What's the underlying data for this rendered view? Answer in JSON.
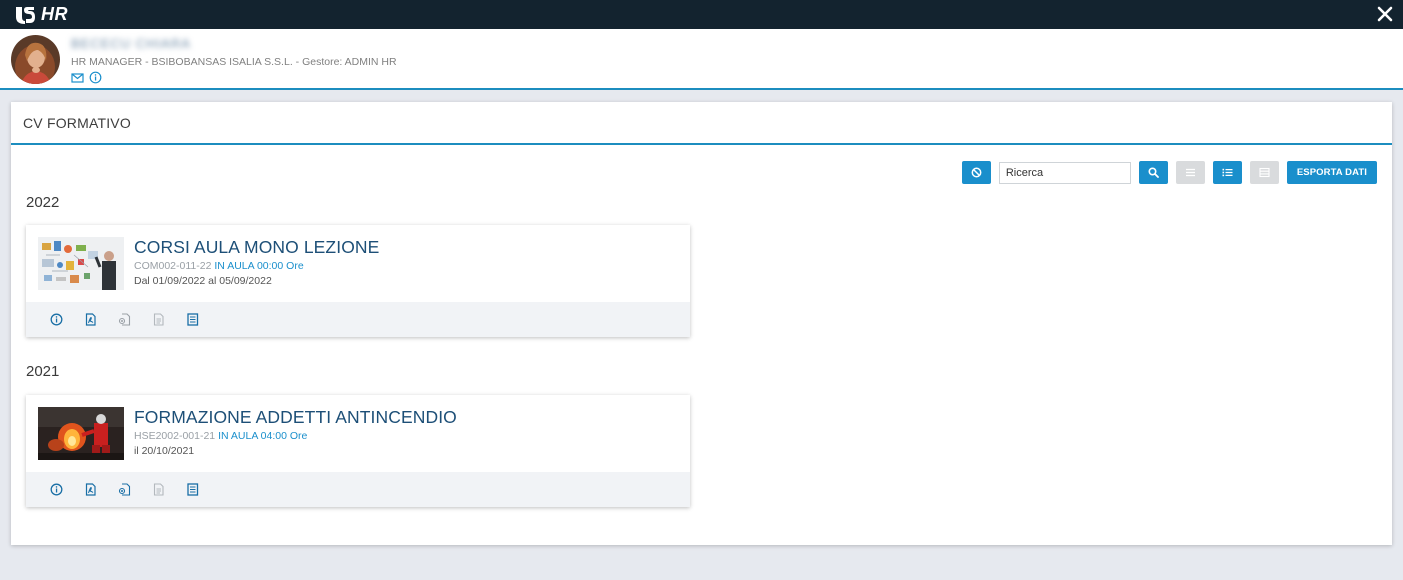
{
  "app": {
    "title": "HR"
  },
  "user": {
    "name": "BECECU CHIARA",
    "role": "HR MANAGER - BSIBOBANSAS ISALIA S.S.L. - Gestore: ADMIN HR"
  },
  "panel": {
    "title": "CV FORMATIVO"
  },
  "toolbar": {
    "search_placeholder": "Ricerca",
    "search_value": "Ricerca",
    "export_label": "ESPORTA DATI"
  },
  "years": [
    {
      "year": "2022",
      "course": {
        "title": "CORSI AULA MONO LEZIONE",
        "code": "COM002-011-22",
        "mode": "IN AULA 00:00 Ore",
        "date": "Dal 01/09/2022 al 05/09/2022"
      }
    },
    {
      "year": "2021",
      "course": {
        "title": "FORMAZIONE ADDETTI ANTINCENDIO",
        "code": "HSE2002-001-21",
        "mode": "IN AULA 04:00 Ore",
        "date": "il 20/10/2021"
      }
    }
  ],
  "icons": {
    "logo": "logo-icon",
    "close": "close-icon",
    "mail": "mail-icon",
    "info": "info-icon",
    "reset": "ban-icon",
    "search": "search-icon",
    "view_compact": "list-lines-icon",
    "view_list": "list-bullets-icon",
    "view_table": "table-icon",
    "card_actions": [
      "info-icon",
      "pdf-document-icon",
      "attachment-document-icon",
      "document-icon",
      "book-icon"
    ]
  },
  "colors": {
    "topbar": "#13232f",
    "accent": "#1a8fcc",
    "title": "#1d4f77",
    "background": "#e6e9ef"
  }
}
